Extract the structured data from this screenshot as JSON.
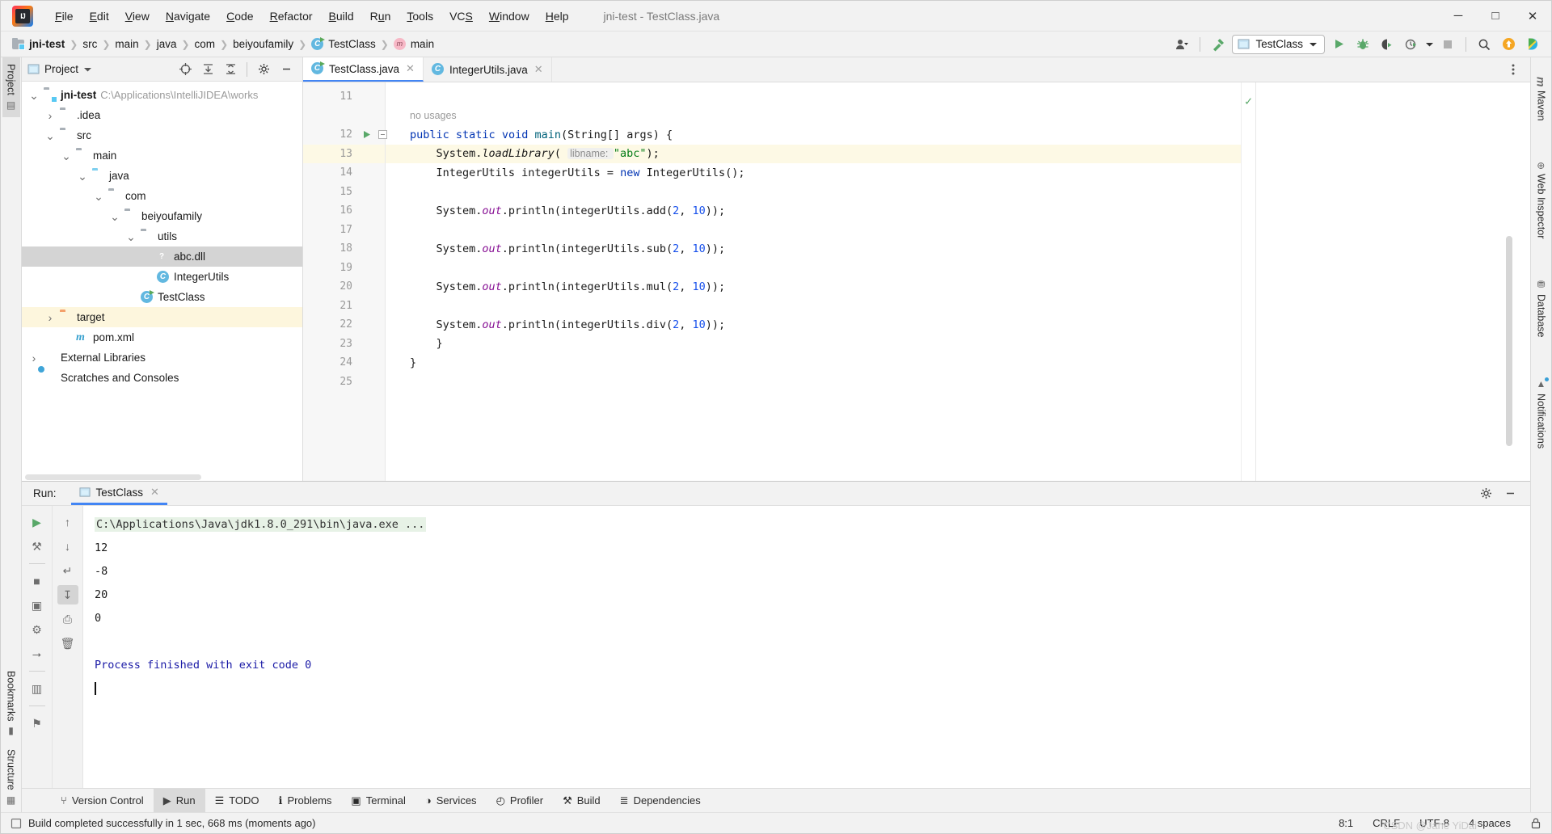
{
  "window": {
    "title": "jni-test - TestClass.java",
    "logo_icon": "intellij-idea-logo",
    "minimize_icon": "─",
    "maximize_icon": "□",
    "close_icon": "✕"
  },
  "menu": [
    {
      "label": "File",
      "mnemonic": "F"
    },
    {
      "label": "Edit",
      "mnemonic": "E"
    },
    {
      "label": "View",
      "mnemonic": "V"
    },
    {
      "label": "Navigate",
      "mnemonic": "N"
    },
    {
      "label": "Code",
      "mnemonic": "C"
    },
    {
      "label": "Refactor",
      "mnemonic": "R"
    },
    {
      "label": "Build",
      "mnemonic": "B"
    },
    {
      "label": "Run",
      "mnemonic": "u"
    },
    {
      "label": "Tools",
      "mnemonic": "T"
    },
    {
      "label": "VCS",
      "mnemonic": "S"
    },
    {
      "label": "Window",
      "mnemonic": "W"
    },
    {
      "label": "Help",
      "mnemonic": "H"
    }
  ],
  "breadcrumb": [
    {
      "label": "jni-test",
      "icon": "module-icon",
      "bold": true
    },
    {
      "label": "src",
      "icon": "",
      "bold": false
    },
    {
      "label": "main",
      "icon": "",
      "bold": false
    },
    {
      "label": "java",
      "icon": "",
      "bold": false
    },
    {
      "label": "com",
      "icon": "",
      "bold": false
    },
    {
      "label": "beiyoufamily",
      "icon": "",
      "bold": false
    },
    {
      "label": "TestClass",
      "icon": "java-class-icon",
      "bold": false
    },
    {
      "label": "main",
      "icon": "method-icon",
      "bold": false
    }
  ],
  "toolbar": {
    "account_icon": "user-account-icon",
    "build_icon": "build-hammer-icon",
    "run_config": "TestClass",
    "run_config_icon": "app-config-icon",
    "dropdown_icon": "chevron-down-icon",
    "run_icon": "run-play-icon",
    "debug_icon": "debug-bug-icon",
    "run_coverage_icon": "run-with-coverage-icon",
    "profile_icon": "profiler-icon",
    "stop_icon": "stop-square-icon",
    "search_icon": "search-magnifier-icon",
    "update_icon": "update-arrow-icon",
    "ai_icon": "ai-assistant-icon"
  },
  "left_strip": [
    {
      "label": "Project",
      "icon": "project-folder-icon",
      "active": true
    },
    {
      "label": "Bookmarks",
      "icon": "bookmark-icon",
      "active": false
    },
    {
      "label": "Structure",
      "icon": "structure-icon",
      "active": false
    }
  ],
  "right_strip": [
    {
      "label": "Maven",
      "icon": "maven-m-icon"
    },
    {
      "label": "Web Inspector",
      "icon": "web-inspector-icon"
    },
    {
      "label": "Database",
      "icon": "database-icon"
    },
    {
      "label": "Notifications",
      "icon": "notifications-bell-icon"
    }
  ],
  "project_panel": {
    "title": "Project",
    "dropdown_icon": "chevron-down-icon",
    "locate_icon": "select-opened-file-icon",
    "expand_icon": "expand-all-icon",
    "collapse_icon": "collapse-all-icon",
    "settings_icon": "gear-icon",
    "hide_icon": "hide-panel-icon",
    "tree": [
      {
        "label": "jni-test",
        "path": "C:\\Applications\\IntelliJIDEA\\works",
        "indent": 0,
        "arrow": "expanded",
        "icon": "module-folder",
        "bold": true,
        "state": "none"
      },
      {
        "label": ".idea",
        "path": "",
        "indent": 1,
        "arrow": "collapsed",
        "icon": "folder",
        "bold": false,
        "state": "none"
      },
      {
        "label": "src",
        "path": "",
        "indent": 1,
        "arrow": "expanded",
        "icon": "folder",
        "bold": false,
        "state": "none"
      },
      {
        "label": "main",
        "path": "",
        "indent": 2,
        "arrow": "expanded",
        "icon": "folder",
        "bold": false,
        "state": "none"
      },
      {
        "label": "java",
        "path": "",
        "indent": 3,
        "arrow": "expanded",
        "icon": "source-folder",
        "bold": false,
        "state": "none"
      },
      {
        "label": "com",
        "path": "",
        "indent": 4,
        "arrow": "expanded",
        "icon": "package",
        "bold": false,
        "state": "none"
      },
      {
        "label": "beiyoufamily",
        "path": "",
        "indent": 5,
        "arrow": "expanded",
        "icon": "package",
        "bold": false,
        "state": "none"
      },
      {
        "label": "utils",
        "path": "",
        "indent": 6,
        "arrow": "expanded",
        "icon": "package",
        "bold": false,
        "state": "none"
      },
      {
        "label": "abc.dll",
        "path": "",
        "indent": 7,
        "arrow": "none",
        "icon": "unknown-file",
        "bold": false,
        "state": "selected"
      },
      {
        "label": "IntegerUtils",
        "path": "",
        "indent": 7,
        "arrow": "none",
        "icon": "java-class",
        "bold": false,
        "state": "none"
      },
      {
        "label": "TestClass",
        "path": "",
        "indent": 6,
        "arrow": "none",
        "icon": "java-class-runnable",
        "bold": false,
        "state": "none"
      },
      {
        "label": "target",
        "path": "",
        "indent": 1,
        "arrow": "collapsed",
        "icon": "excluded-folder",
        "bold": false,
        "state": "highlight"
      },
      {
        "label": "pom.xml",
        "path": "",
        "indent": 2,
        "arrow": "none",
        "icon": "maven-file",
        "bold": false,
        "state": "none"
      },
      {
        "label": "External Libraries",
        "path": "",
        "indent": 0,
        "arrow": "collapsed",
        "icon": "libraries",
        "bold": false,
        "state": "none"
      },
      {
        "label": "Scratches and Consoles",
        "path": "",
        "indent": 0,
        "arrow": "none",
        "icon": "scratches",
        "bold": false,
        "state": "none"
      }
    ]
  },
  "editor": {
    "tabs": [
      {
        "label": "TestClass.java",
        "icon": "java-class-runnable-icon",
        "active": true,
        "close_icon": "✕"
      },
      {
        "label": "IntegerUtils.java",
        "icon": "java-class-icon",
        "active": false,
        "close_icon": "✕"
      }
    ],
    "options_icon": "editor-options-icon",
    "inspection_ok_icon": "inspections-ok-check",
    "lines": [
      {
        "num": "11",
        "kind": "blank",
        "highlight": false,
        "marker": "",
        "fold": ""
      },
      {
        "num": "",
        "kind": "usage",
        "highlight": false,
        "text": "no usages",
        "marker": "",
        "fold": ""
      },
      {
        "num": "12",
        "kind": "code",
        "highlight": false,
        "marker": "run-gutter-icon",
        "fold": "fold-minus",
        "tokens": [
          {
            "t": "public ",
            "c": "kw"
          },
          {
            "t": "static ",
            "c": "kw"
          },
          {
            "t": "void ",
            "c": "kw"
          },
          {
            "t": "main",
            "c": "fn"
          },
          {
            "t": "(String[] args) {",
            "c": ""
          }
        ]
      },
      {
        "num": "13",
        "kind": "code",
        "highlight": true,
        "marker": "",
        "fold": "",
        "tokens": [
          {
            "t": "    System.",
            "c": ""
          },
          {
            "t": "loadLibrary",
            "c": "ital"
          },
          {
            "t": "( ",
            "c": ""
          },
          {
            "t": "libname: ",
            "c": "hintbox"
          },
          {
            "t": "\"abc\"",
            "c": "str"
          },
          {
            "t": ");",
            "c": ""
          }
        ]
      },
      {
        "num": "14",
        "kind": "code",
        "highlight": false,
        "marker": "",
        "fold": "",
        "tokens": [
          {
            "t": "    IntegerUtils integerUtils = ",
            "c": ""
          },
          {
            "t": "new ",
            "c": "kw"
          },
          {
            "t": "IntegerUtils();",
            "c": ""
          }
        ]
      },
      {
        "num": "15",
        "kind": "blank",
        "highlight": false,
        "marker": "",
        "fold": ""
      },
      {
        "num": "16",
        "kind": "code",
        "highlight": false,
        "marker": "",
        "fold": "",
        "tokens": [
          {
            "t": "    System.",
            "c": ""
          },
          {
            "t": "out",
            "c": "ital-purple"
          },
          {
            "t": ".println(integerUtils.add(",
            "c": ""
          },
          {
            "t": "2",
            "c": "num"
          },
          {
            "t": ", ",
            "c": ""
          },
          {
            "t": "10",
            "c": "num"
          },
          {
            "t": "));",
            "c": ""
          }
        ]
      },
      {
        "num": "17",
        "kind": "blank",
        "highlight": false,
        "marker": "",
        "fold": ""
      },
      {
        "num": "18",
        "kind": "code",
        "highlight": false,
        "marker": "",
        "fold": "",
        "tokens": [
          {
            "t": "    System.",
            "c": ""
          },
          {
            "t": "out",
            "c": "ital-purple"
          },
          {
            "t": ".println(integerUtils.sub(",
            "c": ""
          },
          {
            "t": "2",
            "c": "num"
          },
          {
            "t": ", ",
            "c": ""
          },
          {
            "t": "10",
            "c": "num"
          },
          {
            "t": "));",
            "c": ""
          }
        ]
      },
      {
        "num": "19",
        "kind": "blank",
        "highlight": false,
        "marker": "",
        "fold": ""
      },
      {
        "num": "20",
        "kind": "code",
        "highlight": false,
        "marker": "",
        "fold": "",
        "tokens": [
          {
            "t": "    System.",
            "c": ""
          },
          {
            "t": "out",
            "c": "ital-purple"
          },
          {
            "t": ".println(integerUtils.mul(",
            "c": ""
          },
          {
            "t": "2",
            "c": "num"
          },
          {
            "t": ", ",
            "c": ""
          },
          {
            "t": "10",
            "c": "num"
          },
          {
            "t": "));",
            "c": ""
          }
        ]
      },
      {
        "num": "21",
        "kind": "blank",
        "highlight": false,
        "marker": "",
        "fold": ""
      },
      {
        "num": "22",
        "kind": "code",
        "highlight": false,
        "marker": "",
        "fold": "",
        "tokens": [
          {
            "t": "    System.",
            "c": ""
          },
          {
            "t": "out",
            "c": "ital-purple"
          },
          {
            "t": ".println(integerUtils.div(",
            "c": ""
          },
          {
            "t": "2",
            "c": "num"
          },
          {
            "t": ", ",
            "c": ""
          },
          {
            "t": "10",
            "c": "num"
          },
          {
            "t": "));",
            "c": ""
          }
        ]
      },
      {
        "num": "23",
        "kind": "code",
        "highlight": false,
        "marker": "",
        "fold": "fold-minus",
        "tokens": [
          {
            "t": "    }",
            "c": ""
          }
        ]
      },
      {
        "num": "24",
        "kind": "code",
        "highlight": false,
        "marker": "",
        "fold": "",
        "tokens": [
          {
            "t": "}",
            "c": ""
          }
        ]
      },
      {
        "num": "25",
        "kind": "blank",
        "highlight": false,
        "marker": "",
        "fold": ""
      }
    ]
  },
  "run_panel": {
    "label": "Run:",
    "tab": "TestClass",
    "tab_icon": "app-config-icon",
    "tab_close_icon": "✕",
    "settings_icon": "gear-icon",
    "hide_icon": "hide-panel-icon",
    "tools_col1": [
      {
        "icon": "rerun-play-icon",
        "name": "rerun-button",
        "active": false
      },
      {
        "icon": "wrench-icon",
        "name": "edit-configuration-button",
        "active": false
      },
      {
        "icon": "divider",
        "name": "toolbar-divider",
        "active": false
      },
      {
        "icon": "stop-square-icon",
        "name": "stop-button",
        "active": false
      },
      {
        "icon": "camera-icon",
        "name": "dump-threads-button",
        "active": false
      },
      {
        "icon": "bug-restore-icon",
        "name": "restore-layout-button",
        "active": false
      },
      {
        "icon": "exit-icon",
        "name": "exit-button",
        "active": false
      },
      {
        "icon": "divider",
        "name": "toolbar-divider-2",
        "active": false
      },
      {
        "icon": "layout-icon",
        "name": "layout-settings-button",
        "active": false
      },
      {
        "icon": "divider",
        "name": "toolbar-divider-3",
        "active": false
      },
      {
        "icon": "pin-icon",
        "name": "pin-tab-button",
        "active": false
      }
    ],
    "tools_col2": [
      {
        "icon": "arrow-up-icon",
        "name": "previous-occurrence-button",
        "active": false
      },
      {
        "icon": "arrow-down-icon",
        "name": "next-occurrence-button",
        "active": false
      },
      {
        "icon": "soft-wrap-icon",
        "name": "soft-wrap-button",
        "active": false
      },
      {
        "icon": "scroll-to-end-icon",
        "name": "scroll-to-end-button",
        "active": true
      },
      {
        "icon": "print-icon",
        "name": "print-button",
        "active": false
      },
      {
        "icon": "trash-icon",
        "name": "clear-all-button",
        "active": false
      }
    ],
    "console": [
      {
        "text": "C:\\Applications\\Java\\jdk1.8.0_291\\bin\\java.exe ...",
        "style": "command"
      },
      {
        "text": "12",
        "style": "plain"
      },
      {
        "text": "-8",
        "style": "plain"
      },
      {
        "text": "20",
        "style": "plain"
      },
      {
        "text": "0",
        "style": "plain"
      },
      {
        "text": "",
        "style": "plain"
      },
      {
        "text": "Process finished with exit code 0",
        "style": "finished"
      }
    ]
  },
  "bottom_bar": [
    {
      "label": "Version Control",
      "icon": "branch-icon",
      "active": false
    },
    {
      "label": "Run",
      "icon": "run-play-icon",
      "active": true
    },
    {
      "label": "TODO",
      "icon": "todo-list-icon",
      "active": false
    },
    {
      "label": "Problems",
      "icon": "problems-warning-icon",
      "active": false
    },
    {
      "label": "Terminal",
      "icon": "terminal-icon",
      "active": false
    },
    {
      "label": "Services",
      "icon": "services-icon",
      "active": false
    },
    {
      "label": "Profiler",
      "icon": "profiler-icon",
      "active": false
    },
    {
      "label": "Build",
      "icon": "build-hammer-icon",
      "active": false
    },
    {
      "label": "Dependencies",
      "icon": "dependencies-icon",
      "active": false
    }
  ],
  "status_bar": {
    "icon": "build-status-icon",
    "message": "Build completed successfully in 1 sec, 668 ms (moments ago)",
    "caret_position": "8:1",
    "line_separator": "CRLF",
    "encoding": "UTF-8",
    "indent": "4 spaces",
    "lock_icon": "lock-icon",
    "watermark": "CSDN @Jane YiDai"
  },
  "colors": {
    "accent_blue": "#4285f4",
    "run_green": "#59a869",
    "keyword_blue": "#0033b3",
    "string_green": "#067d17",
    "number_blue": "#1750eb",
    "highlight_yellow": "#fdf9e5",
    "console_cmd_bg": "#e7f2e6",
    "finished_blue": "#1a1aa6"
  }
}
